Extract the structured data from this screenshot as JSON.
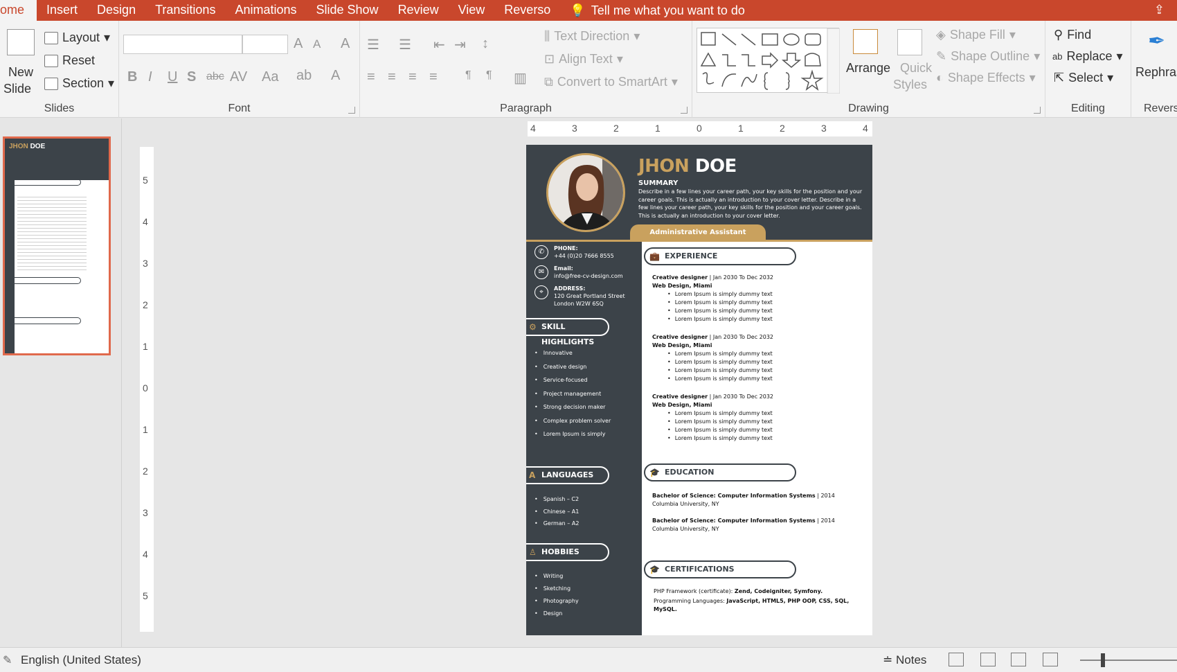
{
  "menu": {
    "tabs": [
      "ome",
      "Insert",
      "Design",
      "Transitions",
      "Animations",
      "Slide Show",
      "Review",
      "View",
      "Reverso"
    ],
    "tell_me": "Tell me what you want to do"
  },
  "ribbon": {
    "slides": {
      "new_slide_line1": "New",
      "new_slide_line2": "Slide",
      "layout": "Layout",
      "reset": "Reset",
      "section": "Section",
      "group_label": "Slides"
    },
    "font": {
      "group_label": "Font"
    },
    "paragraph": {
      "text_direction": "Text Direction",
      "align_text": "Align Text",
      "convert_smartart": "Convert to SmartArt",
      "group_label": "Paragraph"
    },
    "drawing": {
      "arrange": "Arrange",
      "quick_styles_1": "Quick",
      "quick_styles_2": "Styles",
      "shape_fill": "Shape Fill",
      "shape_outline": "Shape Outline",
      "shape_effects": "Shape Effects",
      "group_label": "Drawing"
    },
    "editing": {
      "find": "Find",
      "replace": "Replace",
      "select": "Select",
      "group_label": "Editing"
    },
    "reverso": {
      "rephrase": "Rephras",
      "group_label": "Revers"
    }
  },
  "ruler": {
    "h_labels": [
      "4",
      "3",
      "2",
      "1",
      "0",
      "1",
      "2",
      "3",
      "4"
    ],
    "v_labels": [
      "5",
      "4",
      "3",
      "2",
      "1",
      "0",
      "1",
      "2",
      "3",
      "4",
      "5"
    ]
  },
  "resume": {
    "first_name": "JHON",
    "last_name": "DOE",
    "summary_label": "SUMMARY",
    "summary_text": "Describe in a few lines your career path, your key skills for the position and your career goals. This is actually an introduction to your cover letter. Describe in a few lines your career path, your key skills for the position and your career goals. This is actually an introduction to your cover letter.",
    "job_title": "Administrative Assistant",
    "contact": {
      "phone_label": "PHONE:",
      "phone": "+44 (0)20 7666 8555",
      "email_label": "Email:",
      "email": "info@free-cv-design.com",
      "address_label": "ADDRESS:",
      "address": "120 Great Portland Street London W2W 6SQ"
    },
    "skills_label": "SKILL HIGHLIGHTS",
    "skills": [
      "Innovative",
      "Creative design",
      "Service-focused",
      "Project management",
      "Strong decision maker",
      "Complex problem solver",
      "Lorem Ipsum is simply"
    ],
    "languages_label": "LANGUAGES",
    "languages": [
      "Spanish – C2",
      "Chinese – A1",
      "German – A2"
    ],
    "hobbies_label": "HOBBIES",
    "hobbies": [
      "Writing",
      "Sketching",
      "Photography",
      "Design"
    ],
    "experience_label": "EXPERIENCE",
    "jobs": [
      {
        "role": "Creative designer",
        "dates": " | Jan 2030 To Dec 2032",
        "company": "Web Design, Miami",
        "bullets": [
          "Lorem Ipsum is simply dummy text",
          "Lorem Ipsum is simply dummy text",
          "Lorem Ipsum is simply dummy text",
          "Lorem Ipsum is simply dummy text"
        ]
      },
      {
        "role": "Creative designer",
        "dates": " | Jan 2030 To Dec 2032",
        "company": "Web Design, Miami",
        "bullets": [
          "Lorem Ipsum is simply dummy text",
          "Lorem Ipsum is simply dummy text",
          "Lorem Ipsum is simply dummy text",
          "Lorem Ipsum is simply dummy text"
        ]
      },
      {
        "role": "Creative designer",
        "dates": " | Jan 2030 To Dec 2032",
        "company": "Web Design, Miami",
        "bullets": [
          "Lorem Ipsum is simply dummy text",
          "Lorem Ipsum is simply dummy text",
          "Lorem Ipsum is simply dummy text",
          "Lorem Ipsum is simply dummy text"
        ]
      }
    ],
    "education_label": "EDUCATION",
    "education": [
      {
        "degree": "Bachelor of Science: Computer Information Systems",
        "year": " | 2014",
        "school": "Columbia University, NY"
      },
      {
        "degree": "Bachelor of Science: Computer Information Systems",
        "year": " | 2014",
        "school": "Columbia University, NY"
      }
    ],
    "certifications_label": "CERTIFICATIONS",
    "cert_line1_prefix": "PHP Framework (certificate): ",
    "cert_line1_bold": "Zend, Codeigniter, Symfony.",
    "cert_line2_prefix": "Programming Languages: ",
    "cert_line2_bold": "JavaScript, HTML5, PHP OOP, CSS, SQL, MySQL."
  },
  "status": {
    "language": "English (United States)",
    "notes": "Notes"
  },
  "colors": {
    "accent": "#c9472c",
    "resume_dark": "#3c4349",
    "resume_gold": "#c9a15e",
    "thumb_border": "#e0694c"
  }
}
